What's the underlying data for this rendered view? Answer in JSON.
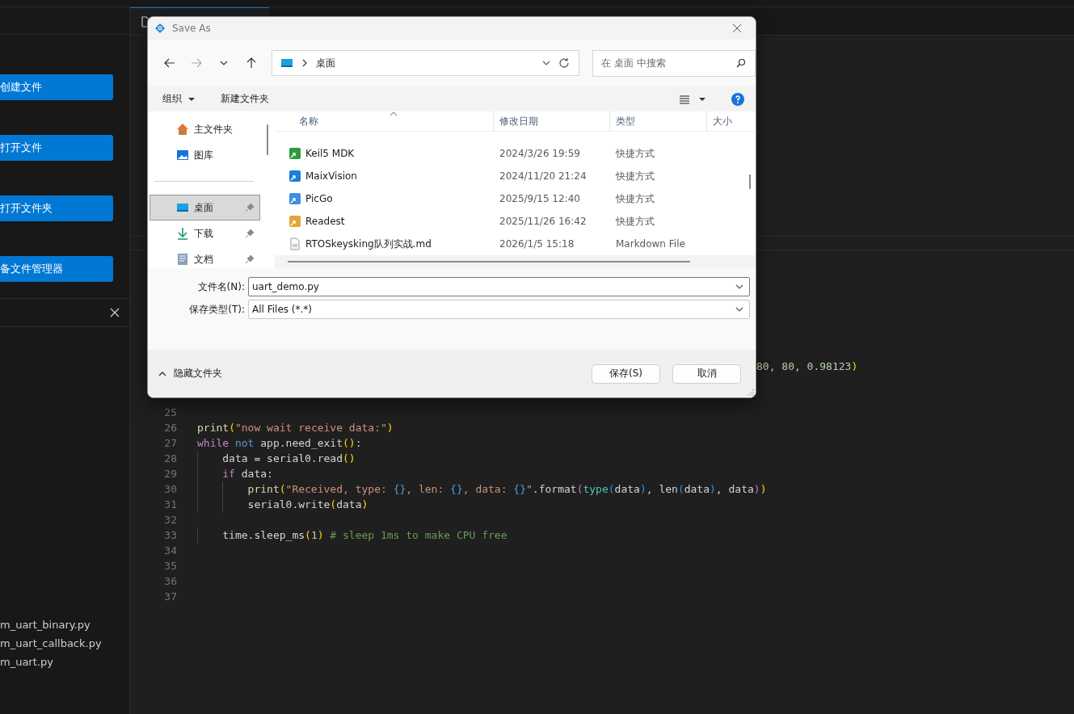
{
  "sidebar": {
    "buttons": [
      "创建文件",
      "打开文件",
      "打开文件夹",
      "备文件管理器"
    ],
    "files": [
      "m_uart_binary.py",
      "m_uart_callback.py",
      "m_uart.py"
    ]
  },
  "editor": {
    "lines": [
      {
        "kind": "tail",
        "tokens": [
          {
            "text": "80, 80, 0.98123",
            "kind": "num"
          },
          {
            "text": ")",
            "kind": "br1"
          }
        ]
      },
      {
        "kind": "code",
        "number": "25"
      },
      {
        "kind": "code",
        "number": "26",
        "tokens": [
          {
            "text": "print",
            "kind": "fn"
          },
          {
            "text": "(",
            "kind": "br1"
          },
          {
            "text": "\"now wait receive data:\"",
            "kind": "str"
          },
          {
            "text": ")",
            "kind": "br1"
          }
        ]
      },
      {
        "kind": "code",
        "number": "27",
        "tokens": [
          {
            "text": "while",
            "kind": "kw"
          },
          {
            "text": " not",
            "kind": "kw2"
          },
          {
            "text": " app.need_exit",
            "kind": "plain"
          },
          {
            "text": "()",
            "kind": "br1"
          },
          {
            "text": ":",
            "kind": "plain"
          }
        ]
      },
      {
        "kind": "code",
        "number": "28",
        "tokens": [
          {
            "text": "    data = serial0.read",
            "kind": "plain"
          },
          {
            "text": "()",
            "kind": "br1"
          }
        ]
      },
      {
        "kind": "code",
        "number": "29",
        "tokens": [
          {
            "text": "    if",
            "kind": "kw"
          },
          {
            "text": " data:",
            "kind": "plain"
          }
        ]
      },
      {
        "kind": "code",
        "number": "30",
        "tokens": [
          {
            "text": "        print",
            "kind": "fn"
          },
          {
            "text": "(",
            "kind": "br1"
          },
          {
            "text": "\"Received, type: ",
            "kind": "str"
          },
          {
            "text": "{}",
            "kind": "kw2"
          },
          {
            "text": ", len: ",
            "kind": "str"
          },
          {
            "text": "{}",
            "kind": "kw2"
          },
          {
            "text": ", data: ",
            "kind": "str"
          },
          {
            "text": "{}",
            "kind": "kw2"
          },
          {
            "text": "\"",
            "kind": "str"
          },
          {
            "text": ".format",
            "kind": "plain"
          },
          {
            "text": "(",
            "kind": "br2"
          },
          {
            "text": "type",
            "kind": "type"
          },
          {
            "text": "(",
            "kind": "br3"
          },
          {
            "text": "data",
            "kind": "plain"
          },
          {
            "text": ")",
            "kind": "br3"
          },
          {
            "text": ", len",
            "kind": "plain"
          },
          {
            "text": "(",
            "kind": "br3"
          },
          {
            "text": "data",
            "kind": "plain"
          },
          {
            "text": ")",
            "kind": "br3"
          },
          {
            "text": ", data",
            "kind": "plain"
          },
          {
            "text": ")",
            "kind": "br2"
          },
          {
            "text": ")",
            "kind": "br1"
          }
        ]
      },
      {
        "kind": "code",
        "number": "31",
        "tokens": [
          {
            "text": "        serial0.write",
            "kind": "plain"
          },
          {
            "text": "(",
            "kind": "br1"
          },
          {
            "text": "data",
            "kind": "plain"
          },
          {
            "text": ")",
            "kind": "br1"
          }
        ]
      },
      {
        "kind": "code",
        "number": "32"
      },
      {
        "kind": "code",
        "number": "33",
        "tokens": [
          {
            "text": "    time.sleep_ms",
            "kind": "plain"
          },
          {
            "text": "(",
            "kind": "br1"
          },
          {
            "text": "1",
            "kind": "num"
          },
          {
            "text": ")",
            "kind": "br1"
          },
          {
            "text": " # sleep 1ms to make CPU free",
            "kind": "cmt"
          }
        ]
      },
      {
        "kind": "code",
        "number": "34"
      },
      {
        "kind": "code",
        "number": "35"
      },
      {
        "kind": "code",
        "number": "36"
      },
      {
        "kind": "code",
        "number": "37"
      }
    ]
  },
  "dialog": {
    "title": "Save As",
    "address": "桌面",
    "search": {
      "placeholder": "在 桌面 中搜索"
    },
    "toolbar": {
      "organize": "组织",
      "new_folder": "新建文件夹"
    },
    "nav_items": [
      {
        "label": "主文件夹",
        "kind": "home",
        "selected": false,
        "pinned": false
      },
      {
        "label": "图库",
        "kind": "gallery",
        "selected": false,
        "pinned": false
      },
      {
        "kind": "separator"
      },
      {
        "label": "桌面",
        "kind": "desktop",
        "selected": true,
        "pinned": true
      },
      {
        "label": "下载",
        "kind": "download",
        "selected": false,
        "pinned": true
      },
      {
        "label": "文档",
        "kind": "document",
        "selected": false,
        "pinned": true
      }
    ],
    "columns": [
      "名称",
      "修改日期",
      "类型",
      "大小"
    ],
    "files": [
      {
        "name": "Keil5 MDK",
        "date": "2024/3/26 19:59",
        "type": "快捷方式",
        "kind": "shortcut",
        "color": "#2e9a3e"
      },
      {
        "name": "MaixVision",
        "date": "2024/11/20 21:24",
        "type": "快捷方式",
        "kind": "shortcut",
        "color": "#1a7fd9"
      },
      {
        "name": "PicGo",
        "date": "2025/9/15 12:40",
        "type": "快捷方式",
        "kind": "shortcut",
        "color": "#3b8fe0"
      },
      {
        "name": "Readest",
        "date": "2025/11/26 16:42",
        "type": "快捷方式",
        "kind": "shortcut",
        "color": "#e0a83a"
      },
      {
        "name": "RTOSkeysking队列实战.md",
        "date": "2026/1/5 15:18",
        "type": "Markdown File",
        "kind": "document"
      }
    ],
    "filename": {
      "label": "文件名(N):",
      "value": "uart_demo.py"
    },
    "filetype": {
      "label": "保存类型(T):",
      "value": "All Files (*.*)"
    },
    "hide_folders": "隐藏文件夹",
    "buttons": [
      "保存(S)",
      "取消"
    ]
  }
}
